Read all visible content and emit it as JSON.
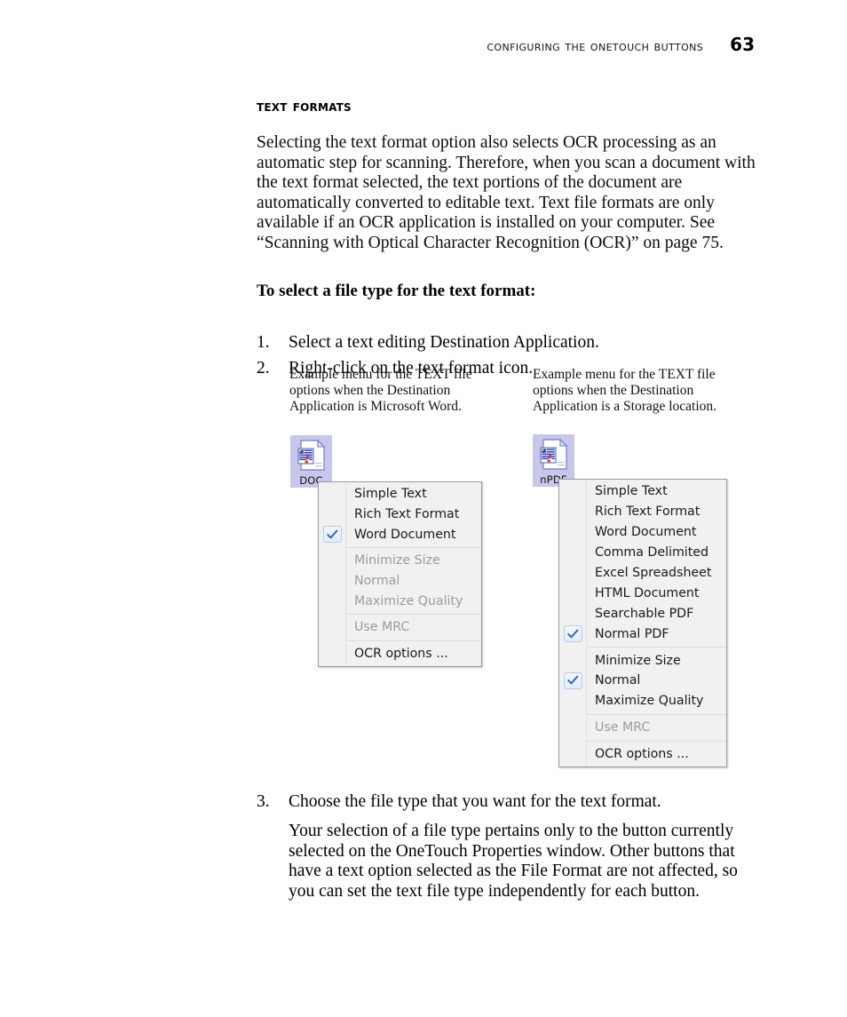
{
  "running_head": {
    "title": "Configuring the OneTouch Buttons",
    "page_number": "63"
  },
  "section": {
    "heading": "Text Formats",
    "intro_paragraph": "Selecting the text format option also selects OCR processing as an automatic step for scanning. Therefore, when you scan a document with the text format selected, the text portions of the document are automatically converted to editable text. Text file formats are only available if an OCR application is installed on your computer. See “Scanning with Optical Character Recognition (OCR)” on page 75.",
    "lead_in": "To select a file type for the text format:"
  },
  "steps": [
    {
      "number": "1.",
      "text": "Select a text editing Destination Application."
    },
    {
      "number": "2.",
      "text": "Right-click on the text format icon."
    },
    {
      "number": "3.",
      "text": "Choose the file type that you want for the text format."
    }
  ],
  "step3_body": "Your selection of a file type pertains only to the button currently selected on the OneTouch Properties window. Other buttons that have a text option selected as the File Format are not affected, so you can set the text file type independently for each button.",
  "figures": {
    "left": {
      "caption": "Example menu for the TEXT file options when the Destination Application is Microsoft Word.",
      "icon_label": "DOC",
      "icon_name": "document-file-icon",
      "menu": [
        {
          "label": "Simple Text",
          "checked": false,
          "disabled": false
        },
        {
          "label": "Rich Text Format",
          "checked": false,
          "disabled": false
        },
        {
          "label": "Word Document",
          "checked": true,
          "disabled": false
        },
        {
          "separator": true
        },
        {
          "label": "Minimize Size",
          "checked": false,
          "disabled": true
        },
        {
          "label": "Normal",
          "checked": false,
          "disabled": true
        },
        {
          "label": "Maximize Quality",
          "checked": false,
          "disabled": true
        },
        {
          "separator": true
        },
        {
          "label": "Use MRC",
          "checked": false,
          "disabled": true
        },
        {
          "separator": true
        },
        {
          "label": "OCR options ...",
          "checked": false,
          "disabled": false
        }
      ]
    },
    "right": {
      "caption": "Example menu for the TEXT file options when the Destination Application is a Storage location.",
      "icon_label": "nPDF",
      "icon_name": "document-file-icon",
      "menu": [
        {
          "label": "Simple Text",
          "checked": false,
          "disabled": false
        },
        {
          "label": "Rich Text Format",
          "checked": false,
          "disabled": false
        },
        {
          "label": "Word Document",
          "checked": false,
          "disabled": false
        },
        {
          "label": "Comma Delimited",
          "checked": false,
          "disabled": false
        },
        {
          "label": "Excel Spreadsheet",
          "checked": false,
          "disabled": false
        },
        {
          "label": "HTML Document",
          "checked": false,
          "disabled": false
        },
        {
          "label": "Searchable PDF",
          "checked": false,
          "disabled": false
        },
        {
          "label": "Normal PDF",
          "checked": true,
          "disabled": false
        },
        {
          "separator": true
        },
        {
          "label": "Minimize Size",
          "checked": false,
          "disabled": false
        },
        {
          "label": "Normal",
          "checked": true,
          "disabled": false
        },
        {
          "label": "Maximize Quality",
          "checked": false,
          "disabled": false
        },
        {
          "separator": true
        },
        {
          "label": "Use MRC",
          "checked": false,
          "disabled": true
        },
        {
          "separator": true
        },
        {
          "label": "OCR options ...",
          "checked": false,
          "disabled": false
        }
      ]
    }
  },
  "colors": {
    "icon_selection_background": "#c8c6ea",
    "menu_background": "#f1f1f1",
    "menu_border": "#9c9c9c",
    "check_mark": "#2b5fb8",
    "disabled_text": "#9b9b9b"
  }
}
